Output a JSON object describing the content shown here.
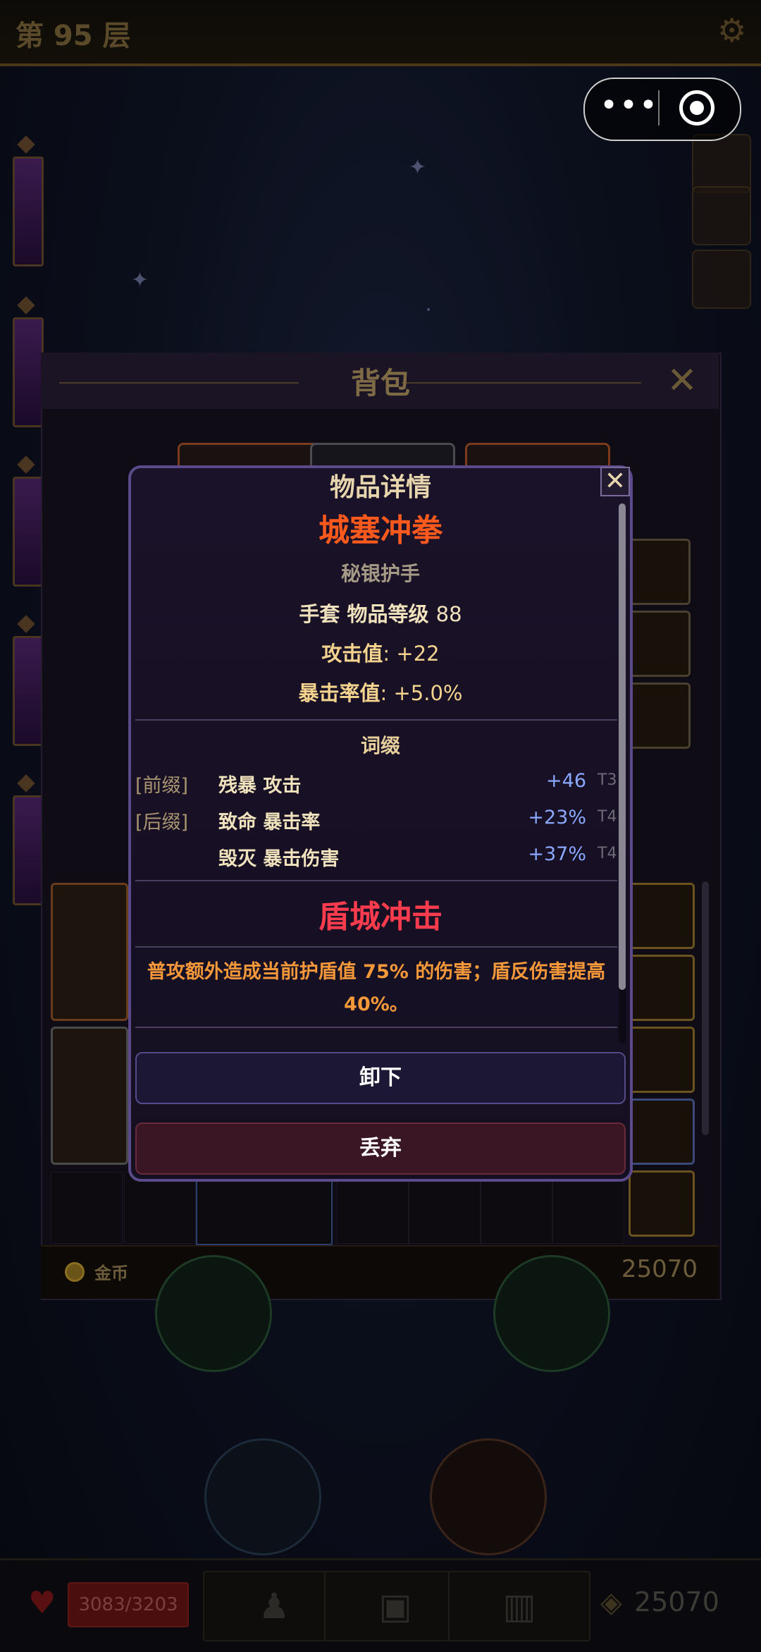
{
  "game": {
    "floor_label": "第 95 层",
    "settings_icon": "gear-icon"
  },
  "miniprogram": {
    "more_icon": "•••",
    "close_icon": "target-circle-icon"
  },
  "bag": {
    "title": "背包",
    "close_icon": "✕",
    "currency_label": "金币",
    "currency_amount": "25070"
  },
  "status": {
    "hp": "3083/3203",
    "gold": "25070"
  },
  "item_detail": {
    "header": "物品详情",
    "close_icon": "✕",
    "name": "城塞冲拳",
    "name_color": "#ff5a1e",
    "base_type": "秘银护手",
    "slot_type": "手套",
    "item_level_label": "物品等级",
    "item_level": "88",
    "stats": [
      {
        "label": "攻击值",
        "value": ": +22"
      },
      {
        "label": "暴击率值",
        "value": ": +5.0%"
      }
    ],
    "affix_title": "词缀",
    "affixes": [
      {
        "tag": "[前缀]",
        "name": "残暴 攻击",
        "value": "+46",
        "tier": "T3"
      },
      {
        "tag": "[后缀]",
        "name": "致命 暴击率",
        "value": "+23%",
        "tier": "T4"
      },
      {
        "tag": "",
        "name": "毁灭 暴击伤害",
        "value": "+37%",
        "tier": "T4"
      }
    ],
    "skill_name": "盾城冲击",
    "skill_description": "普攻额外造成当前护盾值 75% 的伤害；盾反伤害提高 40%。",
    "unequip_label": "卸下",
    "discard_label": "丢弃"
  },
  "nav": {
    "character_icon": "character-icon",
    "bag_icon": "backpack-icon",
    "book_icon": "book-icon"
  }
}
